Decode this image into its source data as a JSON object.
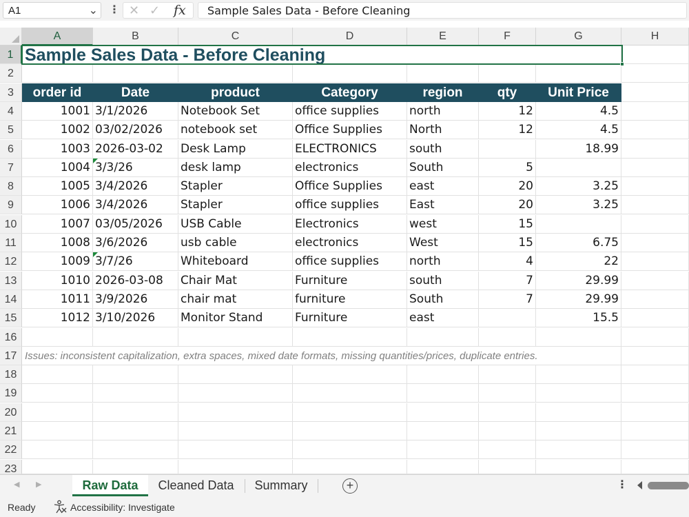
{
  "formula_bar": {
    "name_box": "A1",
    "fx_label": "fx",
    "content": "Sample Sales Data - Before Cleaning"
  },
  "sheet": {
    "columns": [
      "A",
      "B",
      "C",
      "D",
      "E",
      "F",
      "G",
      "H"
    ],
    "rows": [
      "1",
      "2",
      "3",
      "4",
      "5",
      "6",
      "7",
      "8",
      "9",
      "10",
      "11",
      "12",
      "13",
      "14",
      "15",
      "16",
      "17",
      "18",
      "19",
      "20",
      "21",
      "22",
      "23"
    ],
    "title": "Sample Sales Data - Before Cleaning",
    "headers": [
      "order id",
      "Date",
      "product",
      "Category",
      "region",
      "qty",
      "Unit Price"
    ],
    "data": [
      [
        "1001",
        "3/1/2026",
        " Notebook Set",
        "office supplies",
        "north",
        "12",
        "4.5"
      ],
      [
        "1002",
        "03/02/2026",
        "notebook set",
        "Office Supplies",
        "North",
        "12",
        "4.5"
      ],
      [
        "1003",
        "2026-03-02",
        "Desk Lamp",
        "ELECTRONICS",
        "south",
        "",
        "18.99"
      ],
      [
        "1004",
        "3/3/26",
        "desk  lamp",
        "electronics",
        "South",
        "5",
        ""
      ],
      [
        "1005",
        "3/4/2026",
        "Stapler",
        "Office Supplies",
        "east",
        "20",
        "3.25"
      ],
      [
        "1006",
        "3/4/2026",
        "Stapler",
        "office supplies",
        "East",
        "20",
        "3.25"
      ],
      [
        "1007",
        "03/05/2026",
        "USB Cable",
        "Electronics",
        "west",
        "15",
        ""
      ],
      [
        "1008",
        "3/6/2026",
        "usb cable",
        "electronics",
        "West",
        "15",
        "6.75"
      ],
      [
        "1009",
        "3/7/26",
        "Whiteboard",
        "office supplies",
        "north",
        "4",
        "22"
      ],
      [
        "1010",
        "2026-03-08",
        " Chair Mat",
        "Furniture",
        "south",
        "7",
        "29.99"
      ],
      [
        "1011",
        "3/9/2026",
        "chair mat",
        "furniture",
        "South",
        "7",
        "29.99"
      ],
      [
        "1012",
        "3/10/2026",
        "Monitor Stand",
        "Furniture",
        "east",
        "",
        "15.5"
      ]
    ],
    "note": "Issues: inconsistent capitalization, extra spaces, mixed date formats, missing quantities/prices, duplicate entries.",
    "error_flag_cells": [
      "B7",
      "B12"
    ],
    "accent_color": "#217346",
    "header_fill": "#1f4e5f"
  },
  "tabs": [
    {
      "label": "Raw Data",
      "active": true
    },
    {
      "label": "Cleaned Data",
      "active": false
    },
    {
      "label": "Summary",
      "active": false
    }
  ],
  "status": {
    "ready": "Ready",
    "accessibility": "Accessibility: Investigate"
  }
}
